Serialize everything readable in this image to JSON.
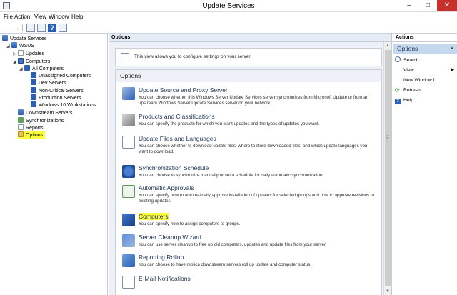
{
  "window": {
    "title": "Update Services",
    "min": "–",
    "max": "□",
    "close": "✕"
  },
  "menu": [
    "File",
    "Action",
    "View",
    "Window",
    "Help"
  ],
  "toolbar": {
    "back": "←",
    "forward": "→",
    "help": "?"
  },
  "tree": {
    "items": [
      {
        "label": "Update Services"
      },
      {
        "label": "WSUS"
      },
      {
        "label": "Updates"
      },
      {
        "label": "Computers"
      },
      {
        "label": "All Computers"
      },
      {
        "label": "Unassigned Computers"
      },
      {
        "label": "Dev Servers"
      },
      {
        "label": "Non-Critical Servers"
      },
      {
        "label": "Production Servers"
      },
      {
        "label": "Windows 10 Workstations"
      },
      {
        "label": "Downstream Servers"
      },
      {
        "label": "Synchronizations"
      },
      {
        "label": "Reports"
      },
      {
        "label": "Options"
      }
    ]
  },
  "center": {
    "header": "Options",
    "intro": "This view allows you to configure settings on your server.",
    "section_title": "Options",
    "options": [
      {
        "label": "Update Source and Proxy Server",
        "desc": "You can choose whether this Windows Server Update Services server synchronizes from Microsoft Update or from an upstream Windows Server Update Services server on your network."
      },
      {
        "label": "Products and Classifications",
        "desc": "You can specify the products for which you want updates and the types of updates you want."
      },
      {
        "label": "Update Files and Languages",
        "desc": "You can choose whether to download update files, where to store downloaded files, and which update languages you want to download."
      },
      {
        "label": "Synchronization Schedule",
        "desc": "You can choose to synchronize manually or set a schedule for daily automatic synchronization."
      },
      {
        "label": "Automatic Approvals",
        "desc": "You can specify how to automatically approve installation of updates for selected groups and how to approve revisions to existing updates."
      },
      {
        "label": "Computers",
        "desc": "You can specify how to assign computers to groups."
      },
      {
        "label": "Server Cleanup Wizard",
        "desc": "You can use server cleanup to free up old computers, updates and update files from your server."
      },
      {
        "label": "Reporting Rollup",
        "desc": "You can choose to have replica downstream servers roll up update and computer status."
      },
      {
        "label": "E-Mail Notifications",
        "desc": ""
      }
    ]
  },
  "actions": {
    "header": "Actions",
    "section": "Options",
    "items": [
      {
        "label": "Search..."
      },
      {
        "label": "View"
      },
      {
        "label": "New Window f..."
      },
      {
        "label": "Refresh"
      },
      {
        "label": "Help"
      }
    ]
  },
  "colors": {
    "highlight": "#ffff3c",
    "close_button": "#c7302b",
    "pane_background": "#edf1f7"
  }
}
